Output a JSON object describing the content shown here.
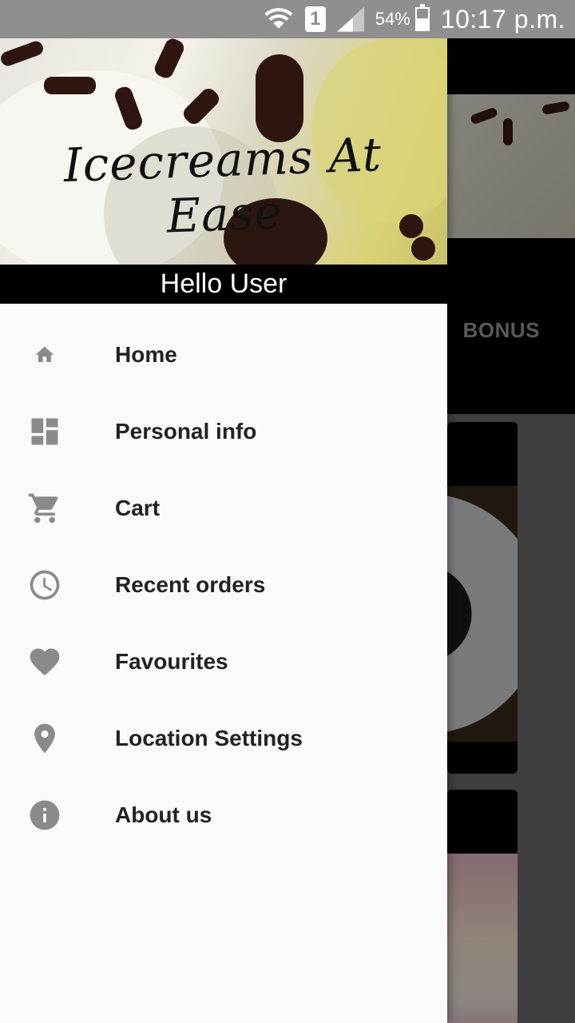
{
  "status_bar": {
    "sim_slot": "1",
    "battery_percent": "54%",
    "battery_level": 0.54,
    "time": "10:17 p.m.",
    "icons": [
      "wifi-icon",
      "sim-icon",
      "signal-icon",
      "battery-icon"
    ]
  },
  "background_app": {
    "visible_tab_label": "BONUS"
  },
  "drawer": {
    "header": {
      "logo_text": "Icecreams At Ease",
      "greeting": "Hello User"
    },
    "items": [
      {
        "label": "Home",
        "icon": "home-icon"
      },
      {
        "label": "Personal info",
        "icon": "dashboard-icon"
      },
      {
        "label": "Cart",
        "icon": "cart-icon"
      },
      {
        "label": "Recent orders",
        "icon": "clock-icon"
      },
      {
        "label": "Favourites",
        "icon": "heart-icon"
      },
      {
        "label": "Location Settings",
        "icon": "location-pin-icon"
      },
      {
        "label": "About us",
        "icon": "info-icon"
      }
    ]
  },
  "colors": {
    "status_bar_bg": "#8f8f8f",
    "drawer_bg": "#fafafa",
    "icon_gray": "#8a8a8a",
    "label_text": "#222222",
    "header_strip": "#000000"
  }
}
